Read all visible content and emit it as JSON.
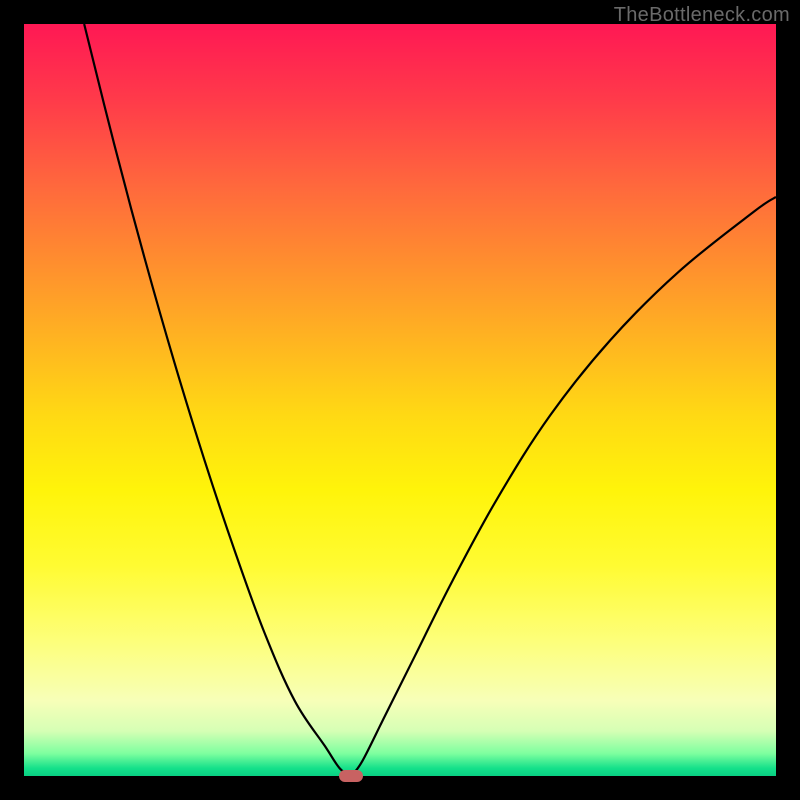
{
  "watermark": "TheBottleneck.com",
  "chart_data": {
    "type": "line",
    "title": "",
    "xlabel": "",
    "ylabel": "",
    "xlim": [
      0,
      100
    ],
    "ylim": [
      0,
      100
    ],
    "grid": false,
    "curves": [
      {
        "name": "left-branch",
        "x": [
          8,
          12,
          16,
          20,
          24,
          28,
          32,
          36,
          40,
          42,
          43.5
        ],
        "y": [
          100,
          84,
          69,
          55,
          42,
          30,
          19,
          10,
          4,
          1,
          0
        ]
      },
      {
        "name": "right-branch",
        "x": [
          43.5,
          45,
          48,
          52,
          57,
          63,
          70,
          78,
          87,
          97,
          100
        ],
        "y": [
          0,
          2,
          8,
          16,
          26,
          37,
          48,
          58,
          67,
          75,
          77
        ]
      }
    ],
    "marker": {
      "x": 43.5,
      "y": 0,
      "color": "#c86262"
    },
    "gradient_stops": [
      {
        "pos": 0.0,
        "color": "#ff1854"
      },
      {
        "pos": 0.5,
        "color": "#ffd914"
      },
      {
        "pos": 0.9,
        "color": "#f7ffb8"
      },
      {
        "pos": 1.0,
        "color": "#09cf83"
      }
    ]
  }
}
